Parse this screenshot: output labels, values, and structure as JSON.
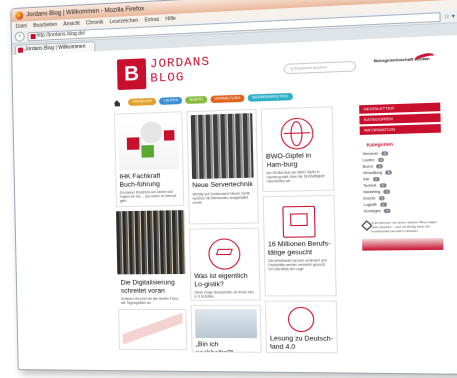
{
  "window": {
    "title": "Jordans Blog | Willkommen - Mozilla Firefox",
    "controls": [
      "–",
      "□",
      "×"
    ]
  },
  "menu": [
    "Datei",
    "Bearbeiten",
    "Ansicht",
    "Chronik",
    "Lesezeichen",
    "Extras",
    "Hilfe"
  ],
  "nav": {
    "back": "‹",
    "url": "http://jordans-blog.de/",
    "right_icons": "☆ ▾ C ⌂"
  },
  "tab": {
    "label": "Jordans Blog | Willkommen"
  },
  "site": {
    "logo_letter": "B",
    "logo_line1": "JORDANS",
    "logo_line2": "BLOG",
    "search_placeholder": "Q  Keyword suchen",
    "company": "Bürogemeinschaft Jordan",
    "categories": [
      {
        "label": "VERNEUER",
        "color": "#e0a12a"
      },
      {
        "label": "LAUFEN",
        "color": "#3b8fd3"
      },
      {
        "label": "BUERO",
        "color": "#86bb3a"
      },
      {
        "label": "VERWALTUNG",
        "color": "#e1631f"
      },
      {
        "label": "WERBEMARKETING",
        "color": "#2db1c6"
      }
    ]
  },
  "cards": [
    {
      "title": "IHK Fachkraft Buch-führung",
      "text": "Ein kleiner Rückblick auf Zahlen und Fakten für Sie ... und wohin es sinnvoll geht."
    },
    {
      "title": "Neue Servertechnik",
      "text": "Wichtig auf Vordermann! Neues Gerät welches mit Mehrkosten ausgestattet wurde."
    },
    {
      "title": "BWO-Gipfel in Ham-burg",
      "text": "Am 05.Mai fand der BWO Gipfel in Hamburg statt, über die Sinnhaftigkeit informierten wir."
    },
    {
      "title": "Die Digitalisierung schreitet voran",
      "text": "Schauen Sie jetzt bei den letzten Fotos der Tagungsleiter an."
    },
    {
      "title": "Was ist eigentlich Lo-gistik?",
      "text": "Diese Frage beantworten wir Ihnen hier in 3 Schritten."
    },
    {
      "title": "16 Millionen Berufs-tätige gesucht",
      "text": "Die Arbeitswelt hat sich verändert und Fachkräfte werden vermehrt gesucht. Ein Überblick der Lage."
    },
    {
      "title": "„Bin ich nachhaltig?“",
      "text": ""
    },
    {
      "title": "Lesung zu Deutsch-land 4.0",
      "text": ""
    }
  ],
  "sidebar": {
    "buttons": [
      "NEWSLETTER",
      "KATEGORIEN",
      "INFORMATION"
    ],
    "heading": "Kategorien",
    "categories": [
      {
        "name": "Verneuer",
        "count": "4"
      },
      {
        "name": "Laufen",
        "count": "6"
      },
      {
        "name": "Buero",
        "count": "3"
      },
      {
        "name": "Verwaltung",
        "count": "8"
      },
      {
        "name": "IHK",
        "count": "2"
      },
      {
        "name": "Technik",
        "count": "5"
      },
      {
        "name": "Marketing",
        "count": "4"
      },
      {
        "name": "Events",
        "count": "3"
      },
      {
        "name": "Logistik",
        "count": "2"
      },
      {
        "name": "Sonstiges",
        "count": "7"
      }
    ],
    "note": "Unternehmen mit einem starken Blog tragen mehr Gewicht – und mit Erfolg kann die Gesellschaft vermehrt mitreden."
  }
}
